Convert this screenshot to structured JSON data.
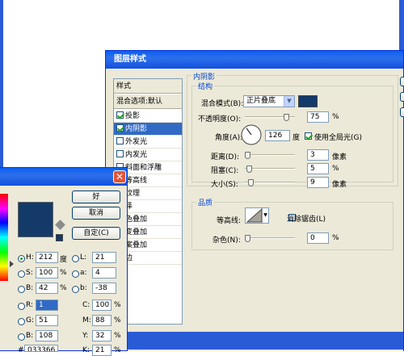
{
  "layer_style": {
    "title": "图层样式",
    "style_list": {
      "header": "样式",
      "blend_default": "混合选项:默认",
      "items": [
        {
          "label": "投影",
          "checked": true,
          "selected": false
        },
        {
          "label": "内阴影",
          "checked": true,
          "selected": true
        },
        {
          "label": "外发光",
          "checked": false,
          "selected": false
        },
        {
          "label": "内发光",
          "checked": false,
          "selected": false
        },
        {
          "label": "斜面和浮雕",
          "checked": false,
          "selected": false
        },
        {
          "label": "等高线",
          "checked": false,
          "selected": false
        },
        {
          "label": "纹理",
          "checked": false,
          "selected": false
        },
        {
          "label": "泽",
          "checked": false,
          "selected": false
        },
        {
          "label": "色叠加",
          "checked": false,
          "selected": false
        },
        {
          "label": "变叠加",
          "checked": false,
          "selected": false
        },
        {
          "label": "案叠加",
          "checked": false,
          "selected": false
        },
        {
          "label": "边",
          "checked": false,
          "selected": false
        }
      ]
    },
    "inner_shadow": {
      "section_title": "内阴影",
      "structure_title": "结构",
      "blend_mode_label": "混合模式(B):",
      "blend_mode_value": "正片叠底",
      "blend_color": "#123a6a",
      "opacity_label": "不透明度(O):",
      "opacity_value": "75",
      "opacity_unit": "%",
      "angle_label": "角度(A):",
      "angle_value": "126",
      "angle_unit": "度",
      "global_light_label": "使用全局光(G)",
      "global_light_checked": true,
      "distance_label": "距离(D):",
      "distance_value": "3",
      "distance_unit": "像素",
      "choke_label": "阻塞(C):",
      "choke_value": "5",
      "choke_unit": "%",
      "size_label": "大小(S):",
      "size_value": "9",
      "size_unit": "像素",
      "quality_title": "品质",
      "contour_label": "等高线:",
      "antialias_label": "消除锯齿(L)",
      "antialias_checked": false,
      "noise_label": "杂色(N):",
      "noise_value": "0",
      "noise_unit": "%"
    }
  },
  "color_picker": {
    "close_glyph": "✕",
    "ok_label": "好",
    "cancel_label": "取消",
    "custom_label": "自定(C)",
    "current_color": "#133a69",
    "fields": {
      "H": {
        "label": "H:",
        "value": "212",
        "unit": "度"
      },
      "S": {
        "label": "S:",
        "value": "100",
        "unit": "%"
      },
      "B": {
        "label": "B:",
        "value": "42",
        "unit": "%"
      },
      "R": {
        "label": "R:",
        "value": "1"
      },
      "G": {
        "label": "G:",
        "value": "51"
      },
      "Bl": {
        "label": "B:",
        "value": "108"
      },
      "L": {
        "label": "L:",
        "value": "21"
      },
      "a": {
        "label": "a:",
        "value": "4"
      },
      "b": {
        "label": "b:",
        "value": "-38"
      },
      "C": {
        "label": "C:",
        "value": "100",
        "unit": "%"
      },
      "M": {
        "label": "M:",
        "value": "88",
        "unit": "%"
      },
      "Y": {
        "label": "Y:",
        "value": "32",
        "unit": "%"
      },
      "K": {
        "label": "K:",
        "value": "21",
        "unit": "%"
      }
    },
    "hex_partial": "033366"
  }
}
